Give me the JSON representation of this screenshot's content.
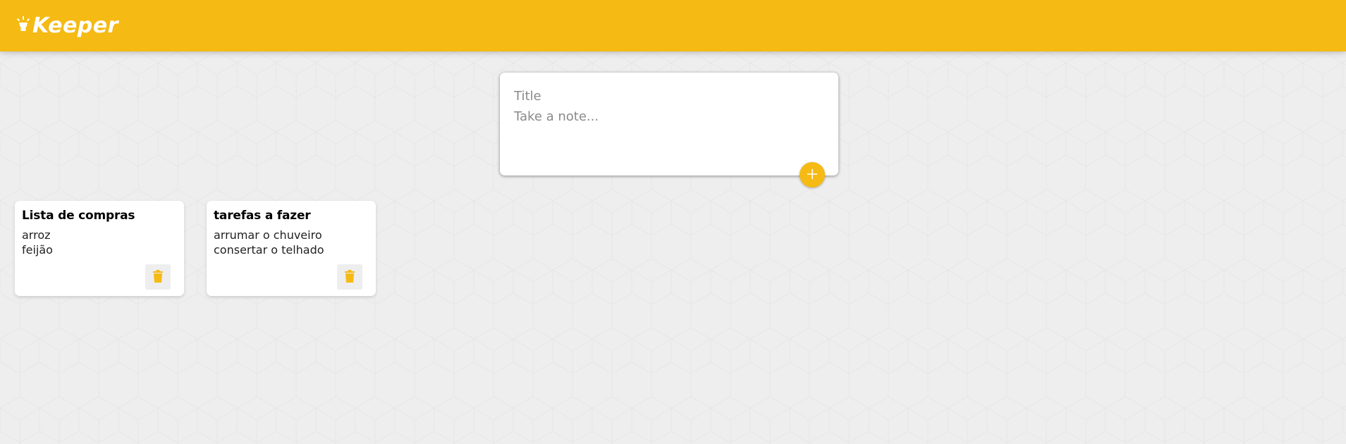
{
  "header": {
    "app_name": "Keeper",
    "icon": "lightbulb-icon",
    "color": "#f5ba13"
  },
  "create_note": {
    "title_placeholder": "Title",
    "content_placeholder": "Take a note...",
    "add_icon": "plus-icon"
  },
  "notes": [
    {
      "title": "Lista de compras",
      "lines": [
        "arroz",
        "feijão"
      ],
      "delete_icon": "trash-icon"
    },
    {
      "title": "tarefas a fazer",
      "lines": [
        "arrumar o chuveiro",
        "consertar o telhado"
      ],
      "delete_icon": "trash-icon"
    }
  ],
  "colors": {
    "accent": "#f5ba13",
    "background": "#eeeeee",
    "card": "#ffffff"
  }
}
